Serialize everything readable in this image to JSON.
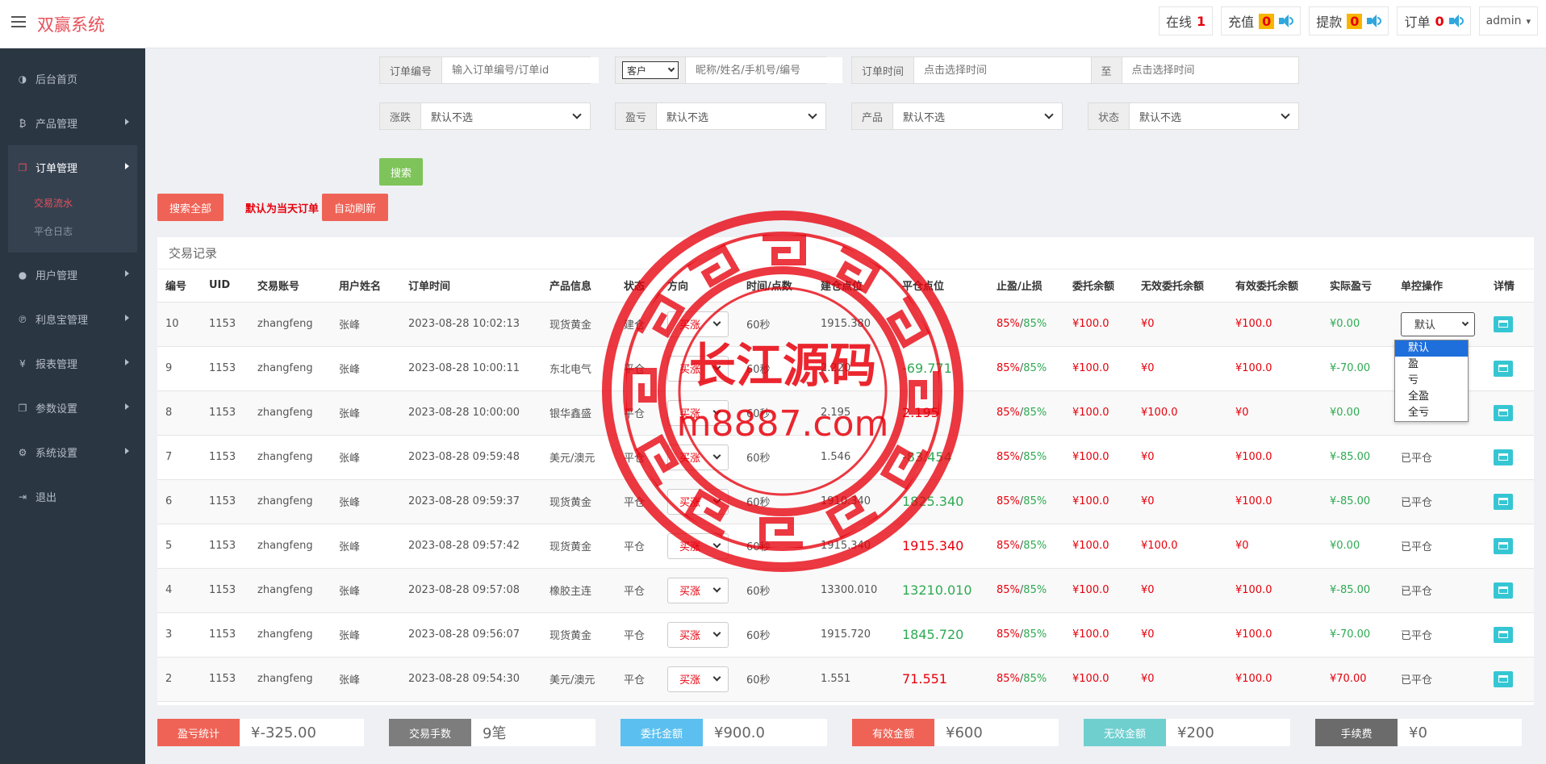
{
  "header": {
    "brand": "双赢系统",
    "stats": [
      {
        "label": "在线",
        "value": "1",
        "boxed": false,
        "speaker": false
      },
      {
        "label": "充值",
        "value": "0",
        "boxed": true,
        "speaker": true
      },
      {
        "label": "提款",
        "value": "0",
        "boxed": true,
        "speaker": true
      },
      {
        "label": "订单",
        "value": "0",
        "boxed": false,
        "speaker": true
      }
    ],
    "user": "admin"
  },
  "sidebar": {
    "items": [
      {
        "label": "后台首页",
        "icon": "dashboard-icon",
        "glyph": "◑",
        "arrow": false
      },
      {
        "label": "产品管理",
        "icon": "bitcoin-icon",
        "glyph": "₿",
        "arrow": true
      },
      {
        "label": "订单管理",
        "icon": "copy-icon",
        "glyph": "❐",
        "arrow": true,
        "active": true,
        "children": [
          {
            "label": "交易流水",
            "active": true
          },
          {
            "label": "平仓日志",
            "active": false
          }
        ]
      },
      {
        "label": "用户管理",
        "icon": "user-icon",
        "glyph": "●",
        "arrow": true
      },
      {
        "label": "利息宝管理",
        "icon": "pinterest-icon",
        "glyph": "℗",
        "arrow": true
      },
      {
        "label": "报表管理",
        "icon": "yen-icon",
        "glyph": "¥",
        "arrow": true
      },
      {
        "label": "参数设置",
        "icon": "files-icon",
        "glyph": "❐",
        "arrow": true
      },
      {
        "label": "系统设置",
        "icon": "gears-icon",
        "glyph": "⚙",
        "arrow": true
      },
      {
        "label": "退出",
        "icon": "sign-out-icon",
        "glyph": "⇥",
        "arrow": false
      }
    ]
  },
  "filters": {
    "order_no": {
      "label": "订单编号",
      "placeholder": "输入订单编号/订单id"
    },
    "customer": {
      "select": "客户",
      "placeholder": "昵称/姓名/手机号/编号"
    },
    "order_time": {
      "label": "订单时间",
      "placeholder": "点击选择时间",
      "to": "至",
      "placeholder2": "点击选择时间"
    },
    "rise_fall": {
      "label": "涨跌",
      "value": "默认不选"
    },
    "profit_loss": {
      "label": "盈亏",
      "value": "默认不选"
    },
    "product": {
      "label": "产品",
      "value": "默认不选"
    },
    "status": {
      "label": "状态",
      "value": "默认不选"
    },
    "search_btn": "搜索",
    "search_all_btn": "搜索全部",
    "note": "默认为当天订单",
    "auto_refresh_btn": "自动刷新"
  },
  "table": {
    "title": "交易记录",
    "columns": [
      "编号",
      "UID",
      "交易账号",
      "用户姓名",
      "订单时间",
      "产品信息",
      "状态",
      "方向",
      "时间/点数",
      "建仓点位",
      "平仓点位",
      "止盈/止损",
      "委托余额",
      "无效委托余额",
      "有效委托余额",
      "实际盈亏",
      "单控操作",
      "详情"
    ],
    "rows": [
      {
        "id": "10",
        "uid": "1153",
        "account": "zhangfeng",
        "name": "张峰",
        "time": "2023-08-28 10:02:13",
        "product": "现货黄金",
        "status": "建仓",
        "dir": "买涨",
        "period": "60秒",
        "open": "1915.380",
        "close": "",
        "close_color": "",
        "tp": "85%",
        "sl": "85%",
        "entrust": "¥100.0",
        "invalid": "¥0",
        "valid": "¥100.0",
        "pnl": "¥0.00",
        "pnl_color": "green",
        "ctrl": "默认",
        "ctrl_select": true
      },
      {
        "id": "9",
        "uid": "1153",
        "account": "zhangfeng",
        "name": "张峰",
        "time": "2023-08-28 10:00:11",
        "product": "东北电气",
        "status": "平仓",
        "dir": "买涨",
        "period": "60秒",
        "open": "2.220",
        "close": "-69.771",
        "close_color": "green",
        "tp": "85%",
        "sl": "85%",
        "entrust": "¥100.0",
        "invalid": "¥0",
        "valid": "¥100.0",
        "pnl": "¥-70.00",
        "pnl_color": "green",
        "ctrl": "",
        "ctrl_select": false
      },
      {
        "id": "8",
        "uid": "1153",
        "account": "zhangfeng",
        "name": "张峰",
        "time": "2023-08-28 10:00:00",
        "product": "银华鑫盛",
        "status": "平仓",
        "dir": "买涨",
        "period": "60秒",
        "open": "2.195",
        "close": "2.195",
        "close_color": "red",
        "tp": "85%",
        "sl": "85%",
        "entrust": "¥100.0",
        "invalid": "¥100.0",
        "valid": "¥0",
        "pnl": "¥0.00",
        "pnl_color": "green",
        "ctrl": "",
        "ctrl_select": false
      },
      {
        "id": "7",
        "uid": "1153",
        "account": "zhangfeng",
        "name": "张峰",
        "time": "2023-08-28 09:59:48",
        "product": "美元/澳元",
        "status": "平仓",
        "dir": "买涨",
        "period": "60秒",
        "open": "1.546",
        "close": "-83.454",
        "close_color": "green",
        "tp": "85%",
        "sl": "85%",
        "entrust": "¥100.0",
        "invalid": "¥0",
        "valid": "¥100.0",
        "pnl": "¥-85.00",
        "pnl_color": "green",
        "ctrl": "已平仓",
        "ctrl_select": false
      },
      {
        "id": "6",
        "uid": "1153",
        "account": "zhangfeng",
        "name": "张峰",
        "time": "2023-08-28 09:59:37",
        "product": "现货黄金",
        "status": "平仓",
        "dir": "买涨",
        "period": "60秒",
        "open": "1910.340",
        "close": "1825.340",
        "close_color": "green",
        "tp": "85%",
        "sl": "85%",
        "entrust": "¥100.0",
        "invalid": "¥0",
        "valid": "¥100.0",
        "pnl": "¥-85.00",
        "pnl_color": "green",
        "ctrl": "已平仓",
        "ctrl_select": false
      },
      {
        "id": "5",
        "uid": "1153",
        "account": "zhangfeng",
        "name": "张峰",
        "time": "2023-08-28 09:57:42",
        "product": "现货黄金",
        "status": "平仓",
        "dir": "买涨",
        "period": "60秒",
        "open": "1915.340",
        "close": "1915.340",
        "close_color": "red",
        "tp": "85%",
        "sl": "85%",
        "entrust": "¥100.0",
        "invalid": "¥100.0",
        "valid": "¥0",
        "pnl": "¥0.00",
        "pnl_color": "green",
        "ctrl": "已平仓",
        "ctrl_select": false
      },
      {
        "id": "4",
        "uid": "1153",
        "account": "zhangfeng",
        "name": "张峰",
        "time": "2023-08-28 09:57:08",
        "product": "橡胶主连",
        "status": "平仓",
        "dir": "买涨",
        "period": "60秒",
        "open": "13300.010",
        "close": "13210.010",
        "close_color": "green",
        "tp": "85%",
        "sl": "85%",
        "entrust": "¥100.0",
        "invalid": "¥0",
        "valid": "¥100.0",
        "pnl": "¥-85.00",
        "pnl_color": "green",
        "ctrl": "已平仓",
        "ctrl_select": false
      },
      {
        "id": "3",
        "uid": "1153",
        "account": "zhangfeng",
        "name": "张峰",
        "time": "2023-08-28 09:56:07",
        "product": "现货黄金",
        "status": "平仓",
        "dir": "买涨",
        "period": "60秒",
        "open": "1915.720",
        "close": "1845.720",
        "close_color": "green",
        "tp": "85%",
        "sl": "85%",
        "entrust": "¥100.0",
        "invalid": "¥0",
        "valid": "¥100.0",
        "pnl": "¥-70.00",
        "pnl_color": "green",
        "ctrl": "已平仓",
        "ctrl_select": false
      },
      {
        "id": "2",
        "uid": "1153",
        "account": "zhangfeng",
        "name": "张峰",
        "time": "2023-08-28 09:54:30",
        "product": "美元/澳元",
        "status": "平仓",
        "dir": "买涨",
        "period": "60秒",
        "open": "1.551",
        "close": "71.551",
        "close_color": "red",
        "tp": "85%",
        "sl": "85%",
        "entrust": "¥100.0",
        "invalid": "¥0",
        "valid": "¥100.0",
        "pnl": "¥70.00",
        "pnl_color": "red",
        "ctrl": "已平仓",
        "ctrl_select": false
      }
    ],
    "ctrl_options": [
      "默认",
      "盈",
      "亏",
      "全盈",
      "全亏"
    ]
  },
  "summary": [
    {
      "label": "盈亏统计",
      "value": "¥-325.00",
      "color": "#ef6356"
    },
    {
      "label": "交易手数",
      "value": "9笔",
      "color": "#7d7d7d"
    },
    {
      "label": "委托金额",
      "value": "¥900.0",
      "color": "#5bc0f0"
    },
    {
      "label": "有效金额",
      "value": "¥600",
      "color": "#ef6356"
    },
    {
      "label": "无效金额",
      "value": "¥200",
      "color": "#6fcfcf"
    },
    {
      "label": "手续费",
      "value": "¥0",
      "color": "#6b6b6b"
    }
  ],
  "watermark": {
    "line1": "长江源码",
    "line2": "m8887.com"
  },
  "colors": {
    "accent_red": "#e7505a",
    "sidebar": "#2b3643",
    "green": "#2eaa52",
    "red": "#e7000b"
  }
}
